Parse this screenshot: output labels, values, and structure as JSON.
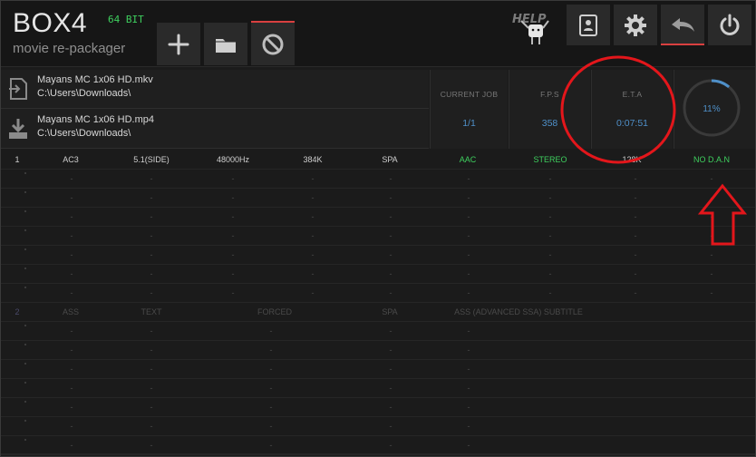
{
  "app": {
    "title": "BOX4",
    "subtitle": "movie re-packager",
    "bit": "64 BIT"
  },
  "toolbar": {
    "add_icon": "plus-icon",
    "open_icon": "folder-icon",
    "cancel_icon": "prohibited-icon"
  },
  "right_toolbar": {
    "help_label": "HELP",
    "items": [
      "contacts-icon",
      "gear-icon",
      "undo-arrow-icon",
      "power-icon"
    ]
  },
  "files": {
    "input_name": "Mayans MC 1x06 HD.mkv",
    "input_path": "C:\\Users\\Downloads\\",
    "output_name": "Mayans MC 1x06 HD.mp4",
    "output_path": "C:\\Users\\Downloads\\"
  },
  "stats": {
    "current_job_label": "CURRENT JOB",
    "current_job": "1/1",
    "fps_label": "F.P.S",
    "fps": "358",
    "eta_label": "E.T.A",
    "eta": "0:07:51",
    "progress_label": "11%",
    "progress": 0.11
  },
  "audio_track": {
    "index": "1",
    "codec": "AC3",
    "channels": "5.1(SIDE)",
    "rate": "48000Hz",
    "bitrate": "384K",
    "lang": "SPA",
    "out_codec": "AAC",
    "out_channels": "STEREO",
    "out_bitrate": "128K",
    "flag": "NO D.A.N"
  },
  "subtitle_track": {
    "index": "2",
    "type": "ASS",
    "kind": "TEXT",
    "forced": "FORCED",
    "lang": "SPA",
    "description": "ASS (ADVANCED SSA) SUBTITLE"
  },
  "placeholder": "-",
  "colors": {
    "accent_blue": "#4f90c9",
    "green": "#3ecf5e",
    "red": "#e3161b",
    "tab_red": "#d94040"
  }
}
